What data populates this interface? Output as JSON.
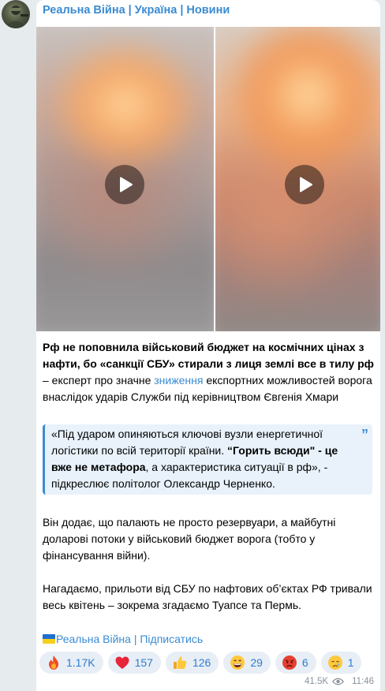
{
  "channel": {
    "name": "Реальна Війна | Україна | Новини"
  },
  "media": {
    "videos": [
      {
        "name": "video-1",
        "play_icon": "play-icon"
      },
      {
        "name": "video-2",
        "play_icon": "play-icon"
      }
    ]
  },
  "post": {
    "p1_bold": "Рф не поповнила військовий бюджет на космічних цінах з нафти, бо «санкції СБУ» стирали з лиця землі все в тилу рф",
    "p1_mid": " – експерт про значне ",
    "p1_link": "зниження",
    "p1_end": " експортних можливостей ворога внаслідок ударів Служби під керівництвом Євгенія Хмари",
    "quote_start": "«Під ударом опиняються ключові вузли енергетичної логістики по всій території країни. ",
    "quote_bold": "“Горить всюди\" - це вже не метафора",
    "quote_end": ", а характеристика ситуації в рф», - підкреслює політолог Олександр Черненко.",
    "p2": "Він додає, що палають не просто резервуари, а майбутні доларові потоки у військовий бюджет ворога (тобто у фінансування війни).",
    "p3": "Нагадаємо, прильоти від СБУ по нафтових об’єктах РФ тривали весь квітень – зокрема згадаємо Туапсе та Пермь."
  },
  "footer": {
    "link_text": "Реальна Війна | Підписатись"
  },
  "reactions": [
    {
      "emoji": "fire",
      "count": "1.17K"
    },
    {
      "emoji": "red-heart",
      "count": "157"
    },
    {
      "emoji": "thumbs-up",
      "count": "126"
    },
    {
      "emoji": "grinning-face",
      "count": "29"
    },
    {
      "emoji": "angry-face",
      "count": "6"
    },
    {
      "emoji": "crying-face",
      "count": "1"
    }
  ],
  "meta": {
    "views": "41.5K",
    "time": "11:46"
  },
  "colors": {
    "accent": "#3a8bd2",
    "background": "#e6ebee",
    "bubble": "#ffffff"
  }
}
